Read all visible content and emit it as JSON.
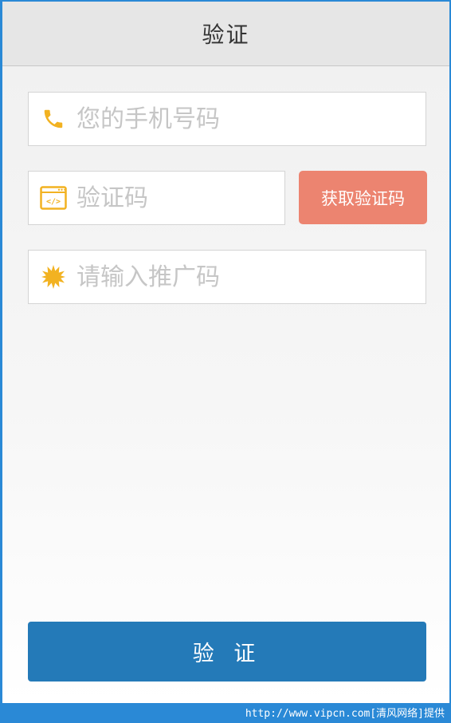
{
  "header": {
    "title": "验证"
  },
  "form": {
    "phone": {
      "placeholder": "您的手机号码",
      "icon": "phone-icon"
    },
    "code": {
      "placeholder": "验证码",
      "icon": "code-window-icon"
    },
    "get_code_label": "获取验证码",
    "promo": {
      "placeholder": "请输入推广码",
      "icon": "star-burst-icon"
    },
    "submit_label": "验 证"
  },
  "watermark": "http://www.vipcn.com[清风网络]提供",
  "colors": {
    "accent_orange": "#ec8470",
    "primary_blue": "#247ab8",
    "icon_yellow": "#f2b221"
  }
}
